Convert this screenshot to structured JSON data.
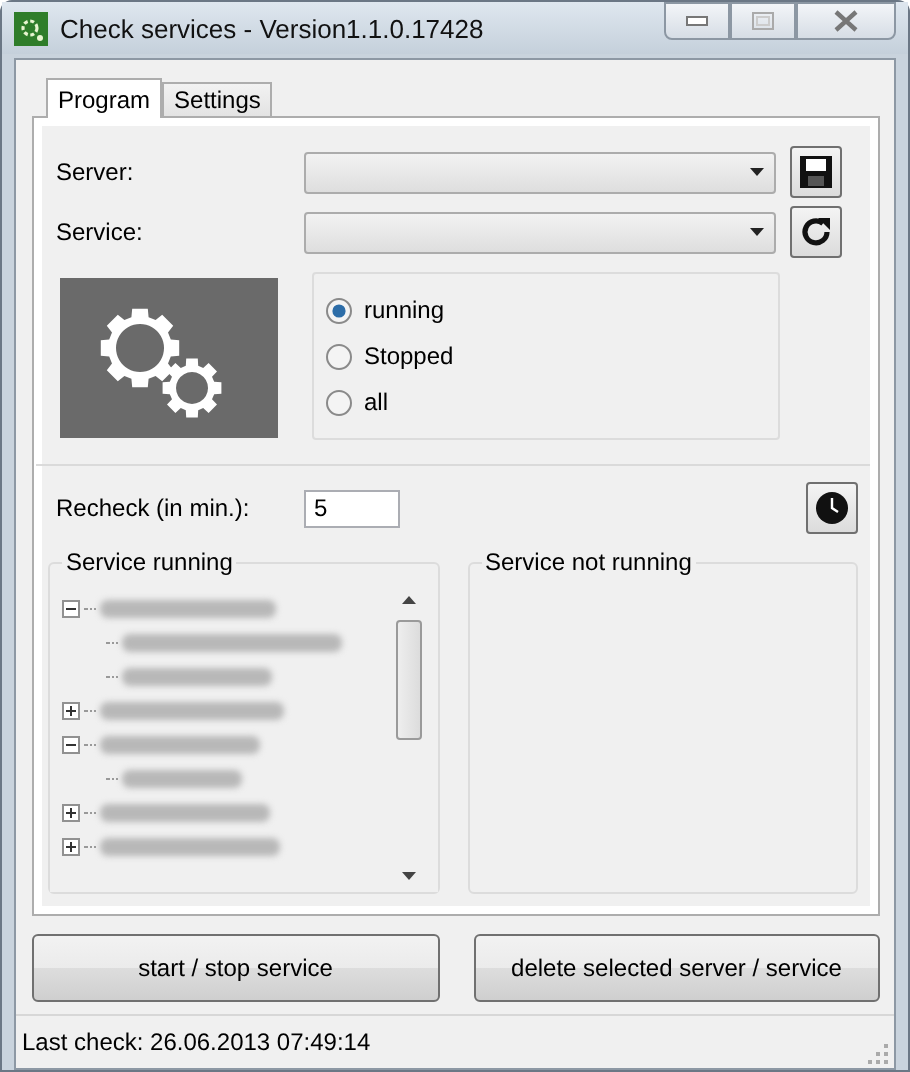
{
  "window": {
    "title": "Check services - Version1.1.0.17428"
  },
  "tabs": [
    {
      "label": "Program",
      "selected": true
    },
    {
      "label": "Settings",
      "selected": false
    }
  ],
  "server": {
    "label": "Server:"
  },
  "service": {
    "label": "Service:"
  },
  "filter": [
    {
      "label": "running",
      "selected": true
    },
    {
      "label": "Stopped",
      "selected": false
    },
    {
      "label": "all",
      "selected": false
    }
  ],
  "recheck": {
    "label": "Recheck (in min.):",
    "value": "5"
  },
  "running_group": {
    "title": "Service running",
    "tree": [
      {
        "kind": "redacted",
        "expanded": true,
        "children": [
          {
            "kind": "redacted"
          },
          {
            "kind": "redacted"
          }
        ]
      },
      {
        "kind": "redacted",
        "expanded": false
      },
      {
        "kind": "redacted",
        "expanded": true,
        "children": [
          {
            "kind": "redacted"
          }
        ]
      },
      {
        "kind": "redacted",
        "expanded": false
      },
      {
        "kind": "redacted",
        "expanded": false
      }
    ]
  },
  "not_running_group": {
    "title": "Service not running"
  },
  "buttons": [
    "start / stop service",
    "delete selected server / service"
  ],
  "status_bar": "Last check: 26.06.2013 07:49:14"
}
